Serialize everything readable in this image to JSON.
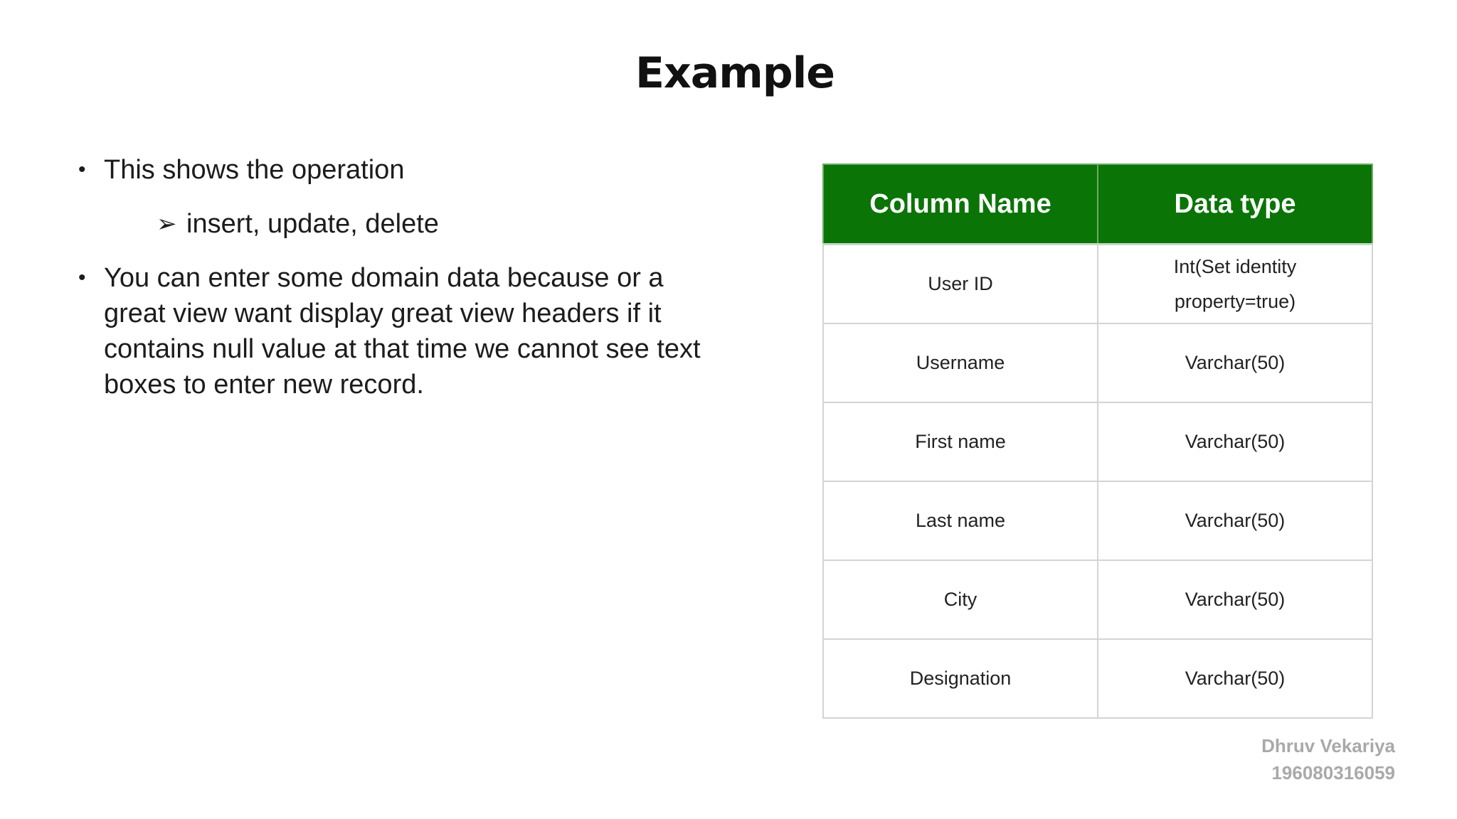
{
  "slide": {
    "title": "Example"
  },
  "bullets": [
    {
      "text": "This shows the operation"
    },
    {
      "text": "You can enter some domain data because or a great view want display great view headers if it contains null value at that time we cannot see text boxes to enter new record."
    }
  ],
  "sub_bullet": {
    "arrow": "➢",
    "text": "insert, update, delete"
  },
  "bullet_symbol": "•",
  "table": {
    "headers": [
      "Column Name",
      "Data type"
    ],
    "rows": [
      [
        "User ID",
        "Int(Set identity property=true)"
      ],
      [
        "Username",
        "Varchar(50)"
      ],
      [
        "First name",
        "Varchar(50)"
      ],
      [
        "Last name",
        "Varchar(50)"
      ],
      [
        "City",
        "Varchar(50)"
      ],
      [
        "Designation",
        "Varchar(50)"
      ]
    ],
    "header_color": "#0a7406"
  },
  "signature": {
    "name": "Dhruv Vekariya",
    "id": "19608031605​9"
  }
}
